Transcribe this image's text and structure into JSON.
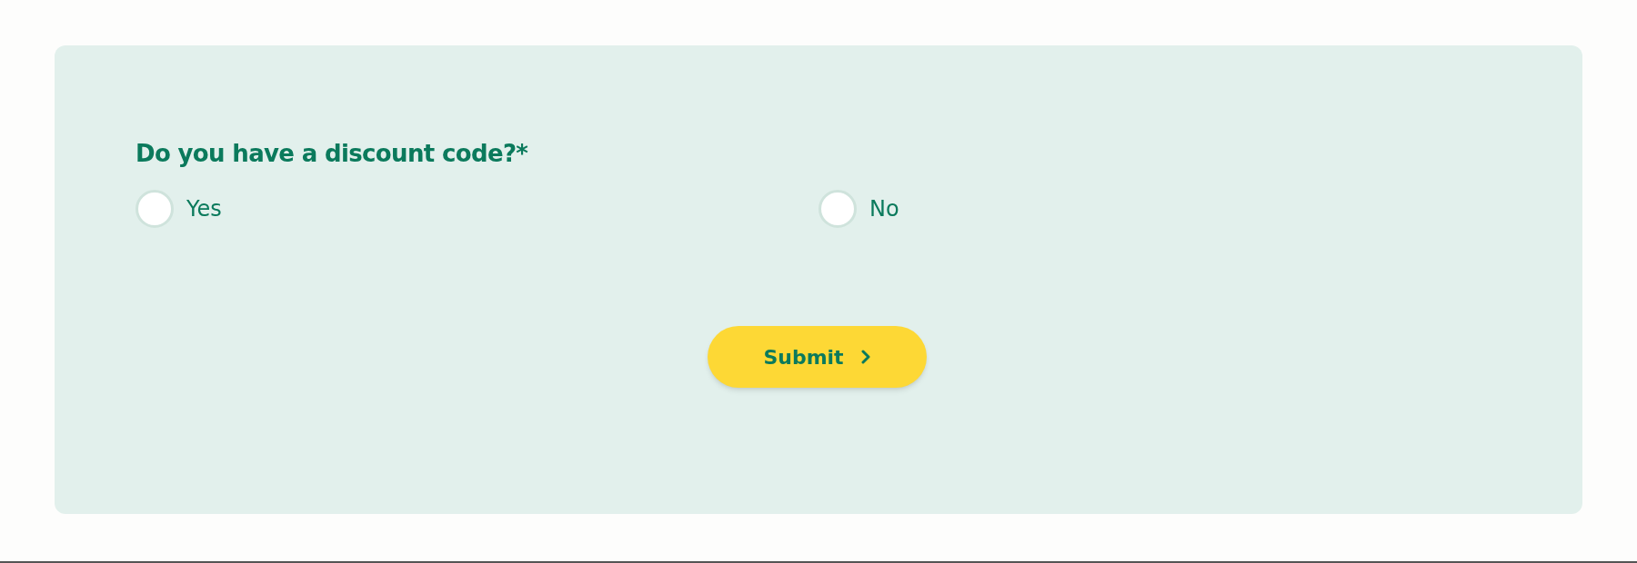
{
  "question": {
    "label": "Do you have a discount code?*"
  },
  "options": [
    {
      "label": "Yes",
      "selected": false
    },
    {
      "label": "No",
      "selected": false
    }
  ],
  "submit": {
    "label": "Submit"
  }
}
